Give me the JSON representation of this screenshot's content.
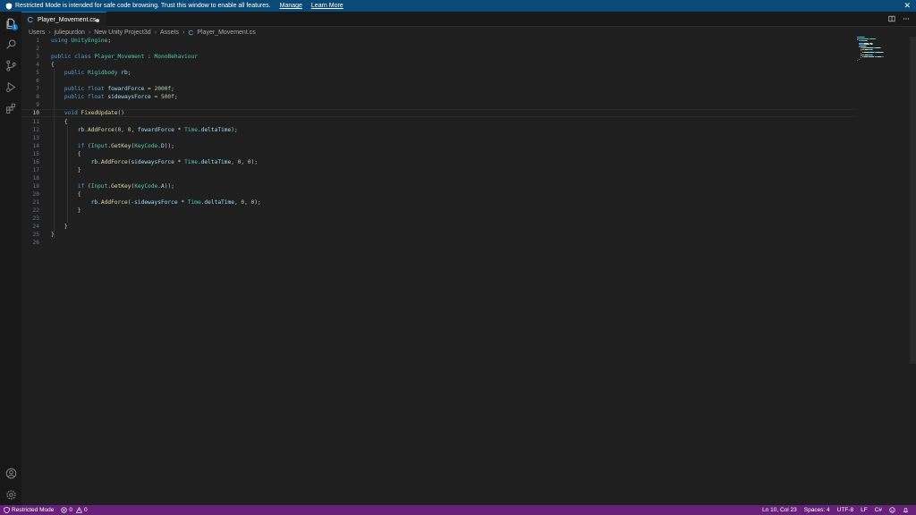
{
  "banner": {
    "message": "Restricted Mode is intended for safe code browsing. Trust this window to enable all features.",
    "manage": "Manage",
    "learn_more": "Learn More"
  },
  "activity_bar": {
    "explorer_badge": "1"
  },
  "tab": {
    "filename": "Player_Movement.cs"
  },
  "breadcrumb": {
    "parts": [
      "Users",
      "juliepurdon",
      "New Unity Project3d",
      "Assets",
      "Player_Movement.cs"
    ]
  },
  "editor": {
    "current_line": 10,
    "lines": [
      {
        "n": "1",
        "tokens": [
          [
            "kw",
            "using "
          ],
          [
            "ty",
            "UnityEngine"
          ],
          [
            "pn",
            ";"
          ]
        ]
      },
      {
        "n": "2",
        "tokens": []
      },
      {
        "n": "3",
        "tokens": [
          [
            "kw",
            "public "
          ],
          [
            "kw",
            "class "
          ],
          [
            "ty",
            "Player_Movement"
          ],
          [
            "pn",
            " : "
          ],
          [
            "ty",
            "MonoBehaviour"
          ]
        ]
      },
      {
        "n": "4",
        "tokens": [
          [
            "pn",
            "{"
          ]
        ]
      },
      {
        "n": "5",
        "tokens": [
          [
            "pn",
            "    "
          ],
          [
            "kw",
            "public "
          ],
          [
            "ty",
            "Rigidbody "
          ],
          [
            "vr",
            "rb"
          ],
          [
            "pn",
            ";"
          ]
        ]
      },
      {
        "n": "6",
        "tokens": []
      },
      {
        "n": "7",
        "tokens": [
          [
            "pn",
            "    "
          ],
          [
            "kw",
            "public "
          ],
          [
            "kw",
            "float "
          ],
          [
            "vr",
            "fowardForce"
          ],
          [
            "pn",
            " = "
          ],
          [
            "nm",
            "2000f"
          ],
          [
            "pn",
            ";"
          ]
        ]
      },
      {
        "n": "8",
        "tokens": [
          [
            "pn",
            "    "
          ],
          [
            "kw",
            "public "
          ],
          [
            "kw",
            "float "
          ],
          [
            "vr",
            "sidewaysForce"
          ],
          [
            "pn",
            " = "
          ],
          [
            "nm",
            "500f"
          ],
          [
            "pn",
            ";"
          ]
        ]
      },
      {
        "n": "9",
        "tokens": []
      },
      {
        "n": "10",
        "tokens": [
          [
            "pn",
            "    "
          ],
          [
            "kw",
            "void "
          ],
          [
            "fn",
            "FixedUpdate"
          ],
          [
            "pn",
            "()"
          ]
        ]
      },
      {
        "n": "11",
        "tokens": [
          [
            "pn",
            "    {"
          ]
        ]
      },
      {
        "n": "12",
        "tokens": [
          [
            "pn",
            "        "
          ],
          [
            "vr",
            "rb"
          ],
          [
            "pn",
            "."
          ],
          [
            "fn",
            "AddForce"
          ],
          [
            "pn",
            "("
          ],
          [
            "nm",
            "0"
          ],
          [
            "pn",
            ", "
          ],
          [
            "nm",
            "0"
          ],
          [
            "pn",
            ", "
          ],
          [
            "vr",
            "fowardForce"
          ],
          [
            "pn",
            " * "
          ],
          [
            "ty",
            "Time"
          ],
          [
            "pn",
            "."
          ],
          [
            "vr",
            "deltaTime"
          ],
          [
            "pn",
            ");"
          ]
        ]
      },
      {
        "n": "13",
        "tokens": []
      },
      {
        "n": "14",
        "tokens": [
          [
            "pn",
            "        "
          ],
          [
            "kw",
            "if "
          ],
          [
            "pn",
            "("
          ],
          [
            "ty",
            "Input"
          ],
          [
            "pn",
            "."
          ],
          [
            "fn",
            "GetKey"
          ],
          [
            "pn",
            "("
          ],
          [
            "ty",
            "KeyCode"
          ],
          [
            "pn",
            "."
          ],
          [
            "vr",
            "D"
          ],
          [
            "pn",
            "));"
          ]
        ]
      },
      {
        "n": "15",
        "tokens": [
          [
            "pn",
            "        {"
          ]
        ]
      },
      {
        "n": "16",
        "tokens": [
          [
            "pn",
            "            "
          ],
          [
            "vr",
            "rb"
          ],
          [
            "pn",
            "."
          ],
          [
            "fn",
            "AddForce"
          ],
          [
            "pn",
            "("
          ],
          [
            "vr",
            "sidewaysForce"
          ],
          [
            "pn",
            " * "
          ],
          [
            "ty",
            "Time"
          ],
          [
            "pn",
            "."
          ],
          [
            "vr",
            "deltaTime"
          ],
          [
            "pn",
            ", "
          ],
          [
            "nm",
            "0"
          ],
          [
            "pn",
            ", "
          ],
          [
            "nm",
            "0"
          ],
          [
            "pn",
            ");"
          ]
        ]
      },
      {
        "n": "17",
        "tokens": [
          [
            "pn",
            "        }"
          ]
        ]
      },
      {
        "n": "18",
        "tokens": []
      },
      {
        "n": "19",
        "tokens": [
          [
            "pn",
            "        "
          ],
          [
            "kw",
            "if "
          ],
          [
            "pn",
            "("
          ],
          [
            "ty",
            "Input"
          ],
          [
            "pn",
            "."
          ],
          [
            "fn",
            "GetKey"
          ],
          [
            "pn",
            "("
          ],
          [
            "ty",
            "KeyCode"
          ],
          [
            "pn",
            "."
          ],
          [
            "vr",
            "A"
          ],
          [
            "pn",
            "));"
          ]
        ]
      },
      {
        "n": "20",
        "tokens": [
          [
            "pn",
            "        {"
          ]
        ]
      },
      {
        "n": "21",
        "tokens": [
          [
            "pn",
            "            "
          ],
          [
            "vr",
            "rb"
          ],
          [
            "pn",
            "."
          ],
          [
            "fn",
            "AddForce"
          ],
          [
            "pn",
            "(-"
          ],
          [
            "vr",
            "sidewaysForce"
          ],
          [
            "pn",
            " * "
          ],
          [
            "ty",
            "Time"
          ],
          [
            "pn",
            "."
          ],
          [
            "vr",
            "deltaTime"
          ],
          [
            "pn",
            ", "
          ],
          [
            "nm",
            "0"
          ],
          [
            "pn",
            ", "
          ],
          [
            "nm",
            "0"
          ],
          [
            "pn",
            ");"
          ]
        ]
      },
      {
        "n": "22",
        "tokens": [
          [
            "pn",
            "        }"
          ]
        ]
      },
      {
        "n": "23",
        "tokens": []
      },
      {
        "n": "24",
        "tokens": [
          [
            "pn",
            "    }"
          ]
        ]
      },
      {
        "n": "25",
        "tokens": [
          [
            "pn",
            "}"
          ]
        ]
      },
      {
        "n": "26",
        "tokens": []
      }
    ]
  },
  "status_bar": {
    "restricted_mode": "Restricted Mode",
    "errors": "0",
    "warnings": "0",
    "position": "Ln 10, Col 23",
    "spaces": "Spaces: 4",
    "encoding": "UTF-8",
    "eol": "LF",
    "language": "C#"
  },
  "colors": {
    "banner": "#0a4a77",
    "status_bar": "#68217a",
    "accent": "#0078d4",
    "keyword": "#569cd6",
    "type": "#4ec9b0",
    "function": "#dcdcaa",
    "variable": "#9cdcfe",
    "number": "#b5cea8"
  },
  "icons": {
    "activity": [
      "files-icon",
      "search-icon",
      "source-control-icon",
      "run-debug-icon",
      "extensions-icon",
      "account-icon",
      "settings-gear-icon"
    ],
    "tab": "csharp-file-icon",
    "banner": "shield-icon",
    "editor_actions": [
      "split-editor-icon",
      "more-actions-icon"
    ],
    "status": [
      "shield-icon",
      "error-icon",
      "warning-icon",
      "notifications-bell-icon",
      "feedback-icon"
    ]
  }
}
